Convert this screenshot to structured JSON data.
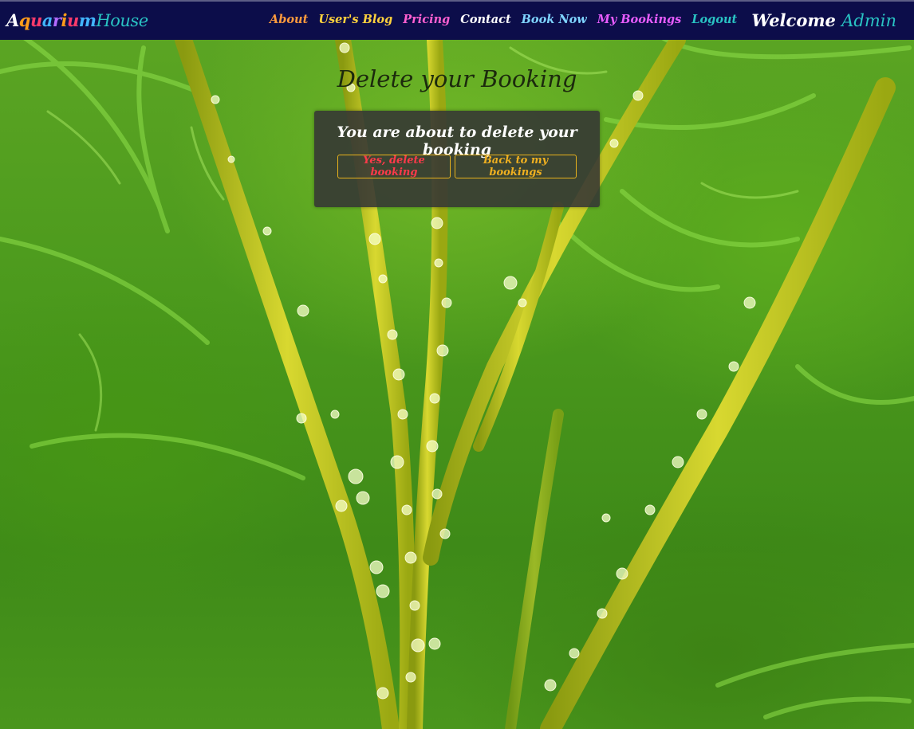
{
  "brand": {
    "p1": "A",
    "p2": "q",
    "p3": "u",
    "p4": "a",
    "p5": "r",
    "p6": "i",
    "p7": "u",
    "p8": "m",
    "house": "House"
  },
  "nav": [
    {
      "label": "About",
      "color": "#ff9b3d"
    },
    {
      "label": "User's Blog",
      "color": "#ffd23d"
    },
    {
      "label": "Pricing",
      "color": "#ff5fd0"
    },
    {
      "label": "Contact",
      "color": "#ffffff"
    },
    {
      "label": "Book Now",
      "color": "#7fd4ff"
    },
    {
      "label": "My Bookings",
      "color": "#e85cff"
    },
    {
      "label": "Logout",
      "color": "#29c3c3"
    }
  ],
  "welcome": {
    "text": "Welcome",
    "user": "Admin"
  },
  "page": {
    "title": "Delete your Booking"
  },
  "card": {
    "message": "You are about to delete your booking",
    "confirm_label": "Yes, delete booking",
    "back_label": "Back to my bookings"
  },
  "colors": {
    "navbar": "#0c0d4a",
    "button_border": "#e8b21c",
    "danger": "#ff3a4a",
    "warning": "#f0b020"
  }
}
